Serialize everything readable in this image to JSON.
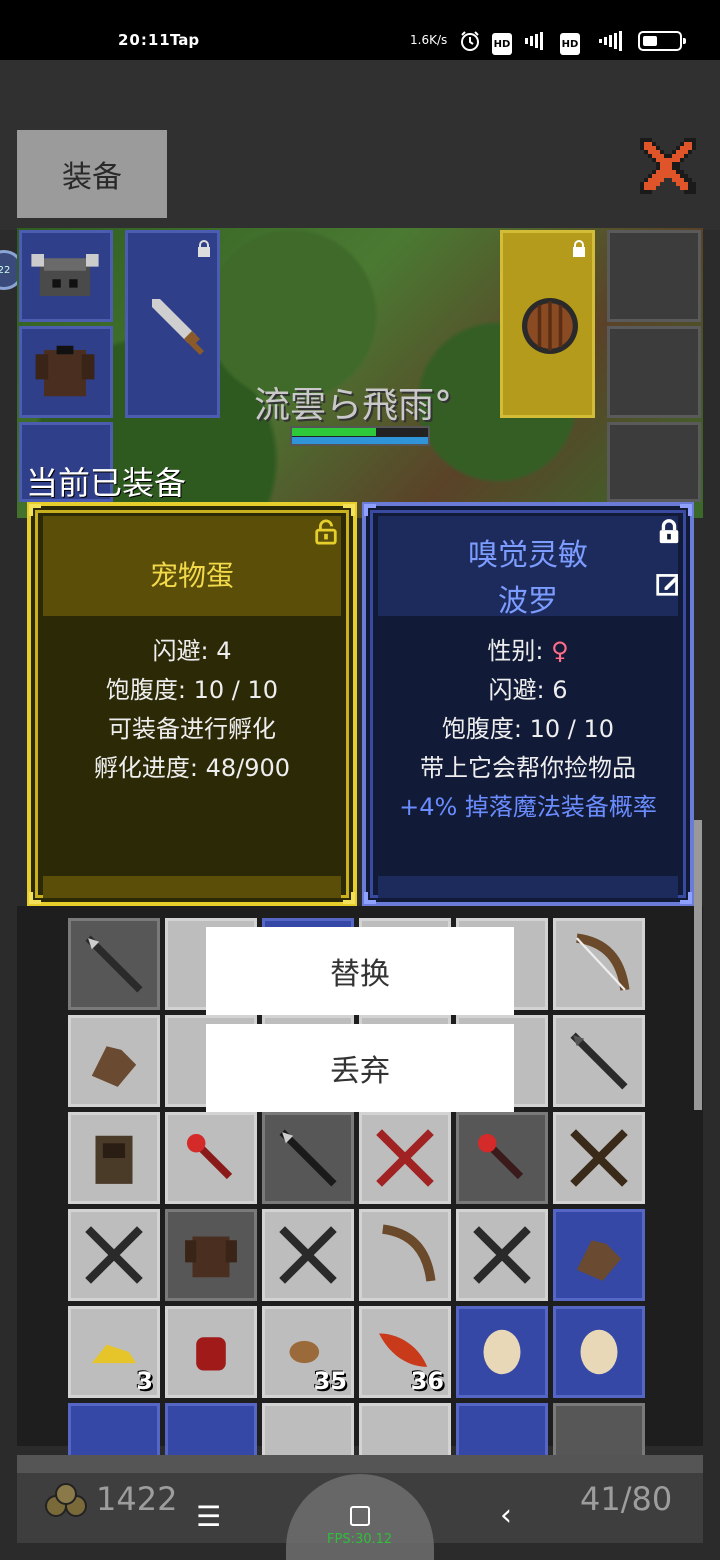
{
  "status_bar": {
    "time": "20:11",
    "app": "Tap",
    "net_speed": "1.6K/s",
    "icons": [
      "alarm-icon",
      "hd-icon",
      "signal-icon",
      "hd-icon",
      "signal-icon",
      "battery-icon"
    ]
  },
  "header": {
    "tab_label": "装备",
    "close_icon": "close-x-icon"
  },
  "side_bubble": "22",
  "scene": {
    "player_name": "流雲ら飛雨°",
    "hp_fraction": 0.62,
    "mp_fraction": 1.0
  },
  "current_equipped_label": "当前已装备",
  "pet_card": {
    "title": "宠物蛋",
    "stats": [
      "闪避: 4",
      "饱腹度: 10 / 10",
      "可装备进行孵化",
      "孵化进度: 48/900"
    ],
    "lock_state": "unlocked"
  },
  "blue_card": {
    "title_line1": "嗅觉灵敏",
    "title_line2": "波罗",
    "gender_label": "性别: ",
    "gender_symbol": "♀",
    "stats": [
      "闪避: 6",
      "饱腹度: 10 / 10",
      "带上它会帮你捡物品"
    ],
    "bonus": "+4% 掉落魔法装备概率",
    "lock_state": "locked"
  },
  "menu": {
    "replace": "替换",
    "discard": "丢弃"
  },
  "inventory_counts": {
    "gold_stack": "3",
    "meat": "35",
    "feather": "36"
  },
  "bottom": {
    "gold": "1422",
    "capacity": "41/80",
    "fps": "FPS:30.12"
  },
  "colors": {
    "pet_border": "#e6cf2c",
    "blue_border": "#6a7bd8",
    "bonus_text": "#6a8cff"
  }
}
